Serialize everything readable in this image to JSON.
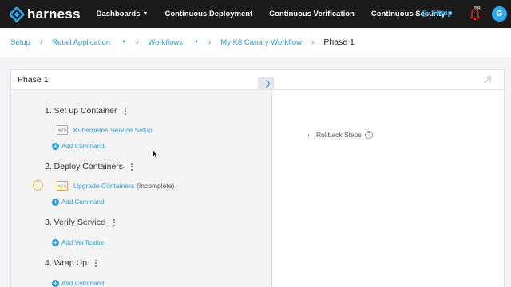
{
  "brand": {
    "name": "harness",
    "accent": "#2aa8f0"
  },
  "nav": {
    "items": [
      {
        "label": "Dashboards",
        "dropdown": true
      },
      {
        "label": "Continuous Deployment",
        "dropdown": false
      },
      {
        "label": "Continuous Verification",
        "dropdown": false
      },
      {
        "label": "Continuous Security",
        "dropdown": true
      }
    ],
    "setup_label": "Setup",
    "notification_count": "58",
    "avatar_initial": "G"
  },
  "breadcrumb": {
    "items": [
      "Setup",
      "Retail Application",
      "Workflows",
      "My K8 Canary Workflow"
    ],
    "current": "Phase 1"
  },
  "panel": {
    "title": "Phase 1",
    "steps": [
      {
        "title": "1. Set up Container",
        "command": "Kubernetes Service Setup",
        "status": "",
        "add_label": "Add Command"
      },
      {
        "title": "2. Deploy Containers",
        "command": "Upgrade Containers",
        "status": "(Incomplete)",
        "add_label": "Add Command"
      },
      {
        "title": "3. Verify Service",
        "add_label": "Add Verification"
      },
      {
        "title": "4. Wrap Up",
        "add_label": "Add Command"
      }
    ],
    "rollback_label": "Rollback Steps"
  }
}
